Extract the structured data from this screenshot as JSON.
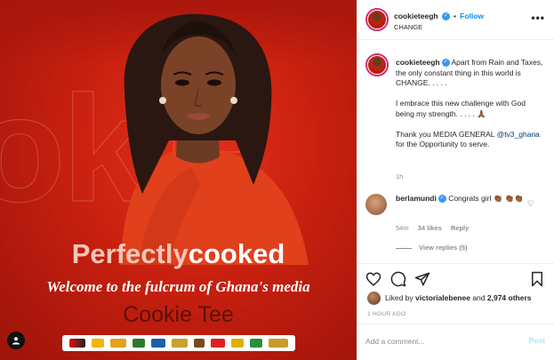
{
  "image": {
    "background_word": "okie",
    "headline_part1": "Perfectly",
    "headline_part2": "cooked",
    "tagline": "Welcome to the fulcrum of Ghana's media",
    "name": "Cookie Tee",
    "sponsor_logos": [
      "logo-1",
      "logo-2",
      "logo-3",
      "logo-4",
      "logo-5",
      "logo-6",
      "logo-7",
      "logo-8",
      "logo-9",
      "logo-10",
      "logo-11"
    ],
    "accent": "#c8200f"
  },
  "header": {
    "username": "cookieteegh",
    "separator": "•",
    "follow_label": "Follow",
    "subtitle": "CHANGE",
    "more_icon": "more-horizontal-icon"
  },
  "caption": {
    "username": "cookieteegh",
    "line1": "Apart from Rain and Taxes, the only constant thing in this world is CHANGE. . . . .",
    "line2": "I embrace this new challenge with God being my strength. . . . . 🙏🏾",
    "line3_pre": "Thank you MEDIA GENERAL",
    "mention": "@tv3_ghana",
    "line3_post": "for the Opportunity to serve.",
    "time": "1h"
  },
  "comment": {
    "username": "berlamundi",
    "text": "Congrats girl 👏🏾 👏🏾👏🏾",
    "time": "54m",
    "likes": "34 likes",
    "reply_label": "Reply",
    "view_replies": "View replies (5)"
  },
  "actions": {
    "liked_by_prefix": "Liked by",
    "liked_by_user": "victorialebenee",
    "liked_by_and": "and",
    "liked_by_count": "2,974 others",
    "post_time": "1 HOUR AGO"
  },
  "add_comment": {
    "placeholder": "Add a comment...",
    "post_label": "Post"
  },
  "colors": {
    "link_blue": "#0095f6",
    "post_disabled": "#b2dffc",
    "verified": "#3897f0"
  }
}
